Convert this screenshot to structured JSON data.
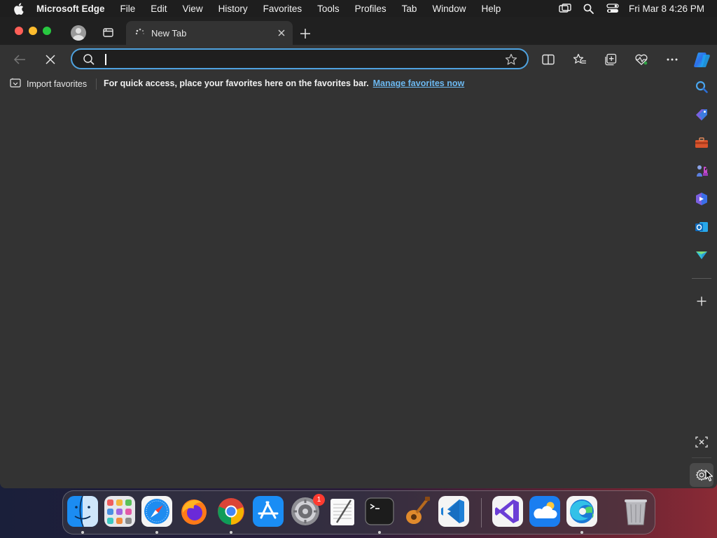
{
  "menubar": {
    "app_name": "Microsoft Edge",
    "items": [
      "File",
      "Edit",
      "View",
      "History",
      "Favorites",
      "Tools",
      "Profiles",
      "Tab",
      "Window",
      "Help"
    ],
    "clock": "Fri Mar 8  4:26 PM"
  },
  "tab": {
    "title": "New Tab"
  },
  "address_bar": {
    "value": "",
    "placeholder": ""
  },
  "favorites_bar": {
    "import_label": "Import favorites",
    "message": "For quick access, place your favorites here on the favorites bar.",
    "link": "Manage favorites now"
  },
  "sidebar": {
    "icons": [
      "search-icon",
      "shopping-tag-icon",
      "tools-icon",
      "games-icon",
      "office-icon",
      "outlook-icon",
      "drop-icon",
      "add-icon",
      "screenshot-icon",
      "settings-icon"
    ]
  },
  "dock": {
    "apps": [
      "Finder",
      "Launchpad",
      "Safari",
      "Firefox",
      "Chrome",
      "App Store",
      "System Settings",
      "TextEdit",
      "Terminal",
      "GarageBand",
      "Visual Studio Code",
      "Visual Studio",
      "OneDrive",
      "Microsoft Edge",
      "Trash"
    ],
    "settings_badge": "1"
  },
  "colors": {
    "accent": "#4fa3e0",
    "link": "#6cb8f0",
    "window_bg": "#333333",
    "titlebar_bg": "#202020"
  }
}
